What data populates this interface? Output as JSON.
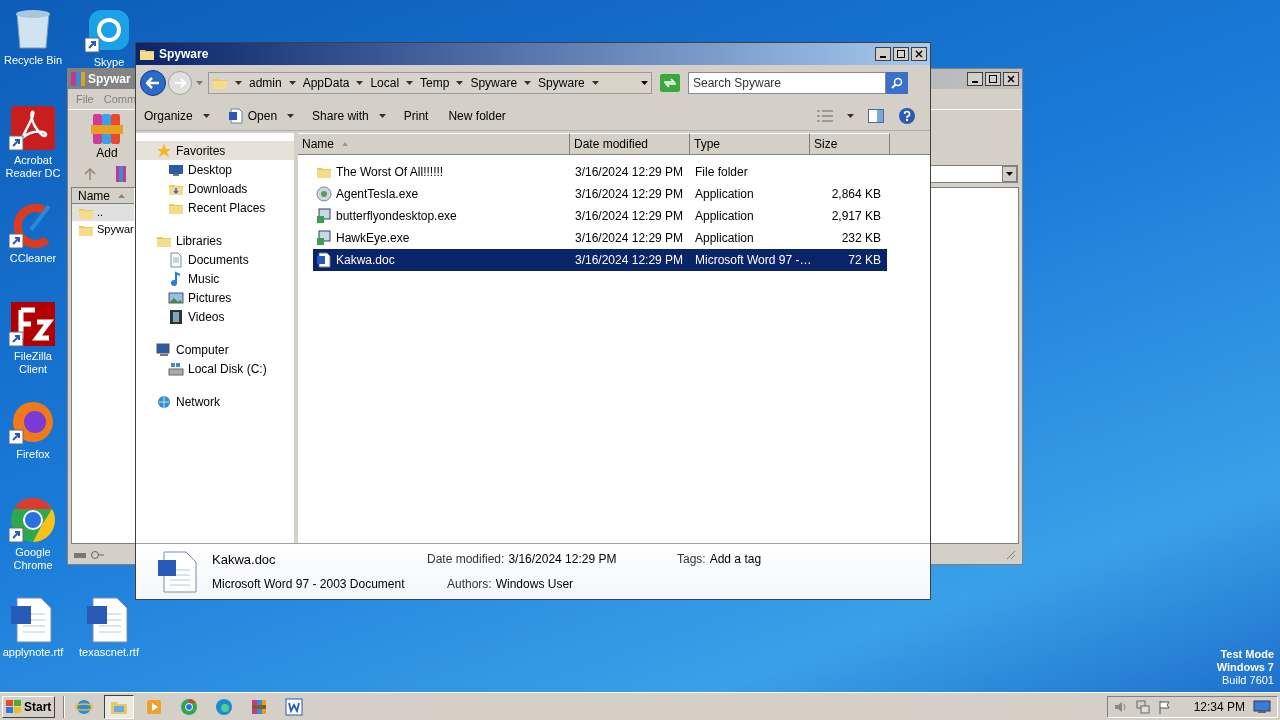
{
  "desktop_icons": [
    {
      "label": "Recycle Bin",
      "kind": "recycle",
      "shortcut": false
    },
    {
      "label": "Skype",
      "kind": "skype",
      "shortcut": true
    },
    {
      "label": "Acrobat Reader DC",
      "kind": "acrobat",
      "shortcut": true
    },
    {
      "label": "CCleaner",
      "kind": "ccleaner",
      "shortcut": true
    },
    {
      "label": "FileZilla Client",
      "kind": "filezilla",
      "shortcut": true
    },
    {
      "label": "Firefox",
      "kind": "firefox",
      "shortcut": true
    },
    {
      "label": "Google Chrome",
      "kind": "chrome",
      "shortcut": true
    },
    {
      "label": "applynote.rtf",
      "kind": "word",
      "shortcut": false
    },
    {
      "label": "texascnet.rtf",
      "kind": "word",
      "shortcut": false
    }
  ],
  "background_window": {
    "title": "Spywar",
    "menu": [
      "File",
      "Comm"
    ],
    "toolbar_button": "Add",
    "column": "Name",
    "items": [
      {
        "name": "..",
        "kind": "up"
      },
      {
        "name": "Spywar",
        "kind": "folder"
      }
    ]
  },
  "explorer": {
    "title": "Spyware",
    "breadcrumb": [
      "admin",
      "AppData",
      "Local",
      "Temp",
      "Spyware",
      "Spyware"
    ],
    "search": {
      "placeholder": "Search Spyware"
    },
    "toolbar": [
      {
        "label": "Organize",
        "kind": "menu"
      },
      {
        "label": "Open",
        "kind": "open-menu"
      },
      {
        "label": "Share with",
        "kind": "menu"
      },
      {
        "label": "Print",
        "kind": "action"
      },
      {
        "label": "New folder",
        "kind": "action"
      }
    ],
    "nav": [
      {
        "label": "Favorites",
        "kind": "star",
        "selected": true,
        "children": [
          {
            "label": "Desktop",
            "kind": "desktop",
            "selected": false
          },
          {
            "label": "Downloads",
            "kind": "downloads",
            "selected": false
          },
          {
            "label": "Recent Places",
            "kind": "recent",
            "selected": false
          }
        ]
      },
      {
        "label": "Libraries",
        "kind": "libraries",
        "selected": false,
        "children": [
          {
            "label": "Documents",
            "kind": "document",
            "selected": false
          },
          {
            "label": "Music",
            "kind": "music",
            "selected": false
          },
          {
            "label": "Pictures",
            "kind": "pictures",
            "selected": false
          },
          {
            "label": "Videos",
            "kind": "videos",
            "selected": false
          }
        ]
      },
      {
        "label": "Computer",
        "kind": "computer",
        "selected": false,
        "children": [
          {
            "label": "Local Disk (C:)",
            "kind": "disk",
            "selected": false
          }
        ]
      },
      {
        "label": "Network",
        "kind": "network",
        "selected": false
      }
    ],
    "columns": [
      "Name",
      "Date modified",
      "Type",
      "Size"
    ],
    "files": [
      {
        "name": "The Worst Of All!!!!!!",
        "date": "3/16/2024 12:29 PM",
        "type": "File folder",
        "kind": "folder",
        "selected": false
      },
      {
        "name": "AgentTesla.exe",
        "date": "3/16/2024 12:29 PM",
        "type": "Application",
        "size": "2,864 KB",
        "kind": "globe",
        "selected": false
      },
      {
        "name": "butterflyondesktop.exe",
        "date": "3/16/2024 12:29 PM",
        "type": "Application",
        "size": "2,917 KB",
        "kind": "installer",
        "selected": false
      },
      {
        "name": "HawkEye.exe",
        "date": "3/16/2024 12:29 PM",
        "type": "Application",
        "size": "232 KB",
        "kind": "installer",
        "selected": false
      },
      {
        "name": "Kakwa.doc",
        "date": "3/16/2024 12:29 PM",
        "type": "Microsoft Word 97 -…",
        "size": "72 KB",
        "kind": "word",
        "selected": true
      }
    ],
    "details": {
      "name": "Kakwa.doc",
      "type": "Microsoft Word 97 - 2003 Document",
      "date_label": "Date modified:",
      "date": "3/16/2024 12:29 PM",
      "tags_label": "Tags:",
      "tags": "Add a tag",
      "authors_label": "Authors:",
      "authors": "Windows User"
    }
  },
  "taskbar": {
    "start": "Start",
    "apps": [
      {
        "kind": "ie",
        "selected": false
      },
      {
        "kind": "explorer",
        "selected": true
      },
      {
        "kind": "media",
        "selected": false
      },
      {
        "kind": "chrome",
        "selected": false
      },
      {
        "kind": "edge",
        "selected": false
      },
      {
        "kind": "winrar",
        "selected": false
      },
      {
        "kind": "word",
        "selected": false
      }
    ],
    "clock": "12:34 PM"
  },
  "test_mode": [
    "Test Mode",
    "Windows 7",
    "Build 7601"
  ]
}
